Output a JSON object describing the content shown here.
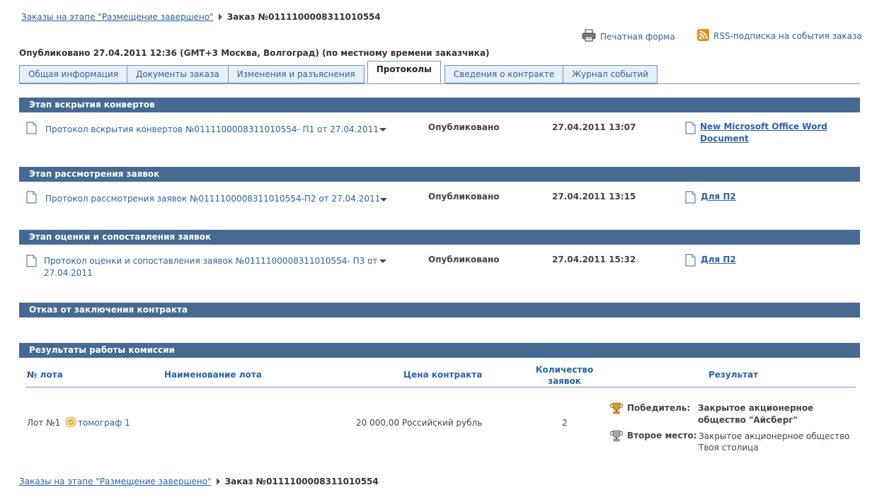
{
  "breadcrumb": {
    "parent": "Заказы на этапе \"Размещение завершено\"",
    "current": "Заказ №0111100008311010554"
  },
  "toplinks": {
    "print": "Печатная форма",
    "rss": "RSS-подписка на события заказа"
  },
  "published": "Опубликовано 27.04.2011 12:36 (GMT+3 Москва, Волгоград) (по местному времени заказчика)",
  "tabs": [
    {
      "label": "Общая информация"
    },
    {
      "label": "Документы заказа"
    },
    {
      "label": "Изменения и разъяснения"
    },
    {
      "label": "Протоколы"
    },
    {
      "label": "Сведения о контракте"
    },
    {
      "label": "Журнал событий"
    }
  ],
  "sections": [
    {
      "title": "Этап вскрытия конвертов",
      "protocol": "Протокол вскрытия конвертов №0111100008311010554- П1 от 27.04.2011",
      "status": "Опубликовано",
      "date": "27.04.2011 13:07",
      "file": "New Microsoft Office Word Document"
    },
    {
      "title": "Этап рассмотрения заявок",
      "protocol": "Протокол рассмотрения заявок №0111100008311010554-П2 от 27.04.2011",
      "status": "Опубликовано",
      "date": "27.04.2011 13:15",
      "file": "Для П2"
    },
    {
      "title": "Этап оценки и сопоставления заявок",
      "protocol_line1": "Протокол оценки и сопоставления заявок №0111100008311010554- П3 от",
      "protocol_line2": "27.04.2011",
      "status": "Опубликовано",
      "date": "27.04.2011 15:32",
      "file": "Для П2"
    },
    {
      "title": "Отказ от заключения контракта"
    },
    {
      "title": "Результаты работы комиссии"
    }
  ],
  "results": {
    "headers": {
      "lot_no": "№ лота",
      "lot_name": "Наименование лота",
      "price": "Цена контракта",
      "count_line1": "Количество",
      "count_line2": "заявок",
      "result": "Результат"
    },
    "row": {
      "lot_no": "Лот №1",
      "lot_name": "томограф 1",
      "price": "20 000,00 Российский рубль",
      "count": "2",
      "winner_label": "Победитель:",
      "winner_line1": "Закрытое акционерное",
      "winner_line2": "общество \"Айсберг\"",
      "second_label": "Второе место:",
      "second_line1": "Закрытое акционерное общество",
      "second_line2": "Твоя столица"
    }
  },
  "colors": {
    "section_bar": "#466a91",
    "link": "#2a63a6",
    "tab_bg": "#e6eef8",
    "tab_border": "#6f95c2"
  }
}
